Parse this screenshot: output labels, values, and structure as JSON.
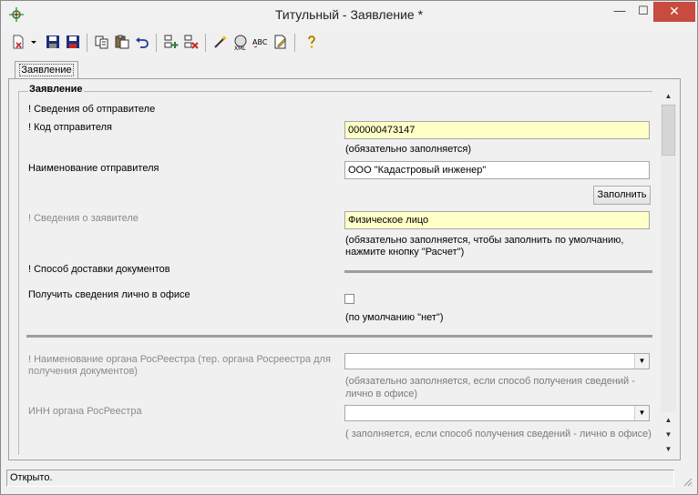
{
  "window": {
    "title": "Титульный - Заявление *",
    "minimize_glyph": "—",
    "maximize_glyph": "☐",
    "close_glyph": "✕"
  },
  "toolbar": {
    "buttons": [
      {
        "name": "new-document-icon"
      },
      {
        "name": "dropdown-arrow-icon"
      },
      {
        "name": "save-icon"
      },
      {
        "name": "save-as-icon"
      },
      {
        "name": "copy-icon"
      },
      {
        "name": "paste-icon"
      },
      {
        "name": "undo-icon"
      },
      {
        "name": "add-row-icon"
      },
      {
        "name": "delete-row-icon"
      },
      {
        "name": "wand-icon"
      },
      {
        "name": "xml-icon"
      },
      {
        "name": "spellcheck-icon"
      },
      {
        "name": "edit-document-icon"
      },
      {
        "name": "help-icon"
      }
    ]
  },
  "tabs": [
    {
      "label": "Заявление"
    }
  ],
  "form": {
    "group_title": "Заявление",
    "sender_section": "! Сведения об отправителе",
    "sender_code_label": "! Код отправителя",
    "sender_code_value": "000000473147",
    "sender_code_hint": "(обязательно заполняется)",
    "sender_name_label": "Наименование отправителя",
    "sender_name_value": "ООО \"Кадастровый инженер\"",
    "fill_button": "Заполнить",
    "applicant_label": "! Сведения о заявителе",
    "applicant_value": "Физическое лицо",
    "applicant_hint_1": "(обязательно заполняется, чтобы заполнить по умолчанию,",
    "applicant_hint_2": "нажмите кнопку \"Расчет\")",
    "delivery_label": "! Способ доставки документов",
    "in_office_label": "Получить сведения лично в офисе",
    "in_office_hint": "(по умолчанию \"нет\")",
    "in_office_checked": false,
    "rosreestr_organ_label_1": "! Наименование органа РосРеестра (тер. органа Росреестра для",
    "rosreestr_organ_label_2": "получения документов)",
    "rosreestr_organ_value": "",
    "rosreestr_organ_hint_1": "(обязательно заполняется, если способ получения сведений -",
    "rosreestr_organ_hint_2": "лично в офисе)",
    "inn_label": "ИНН органа РосРеестра",
    "inn_value": "",
    "inn_hint": "( заполняется, если способ получения сведений - лично в офисе)"
  },
  "status": {
    "text": "Открыто."
  },
  "colors": {
    "required_field": "#ffffc8",
    "close_button": "#c74b3f"
  }
}
